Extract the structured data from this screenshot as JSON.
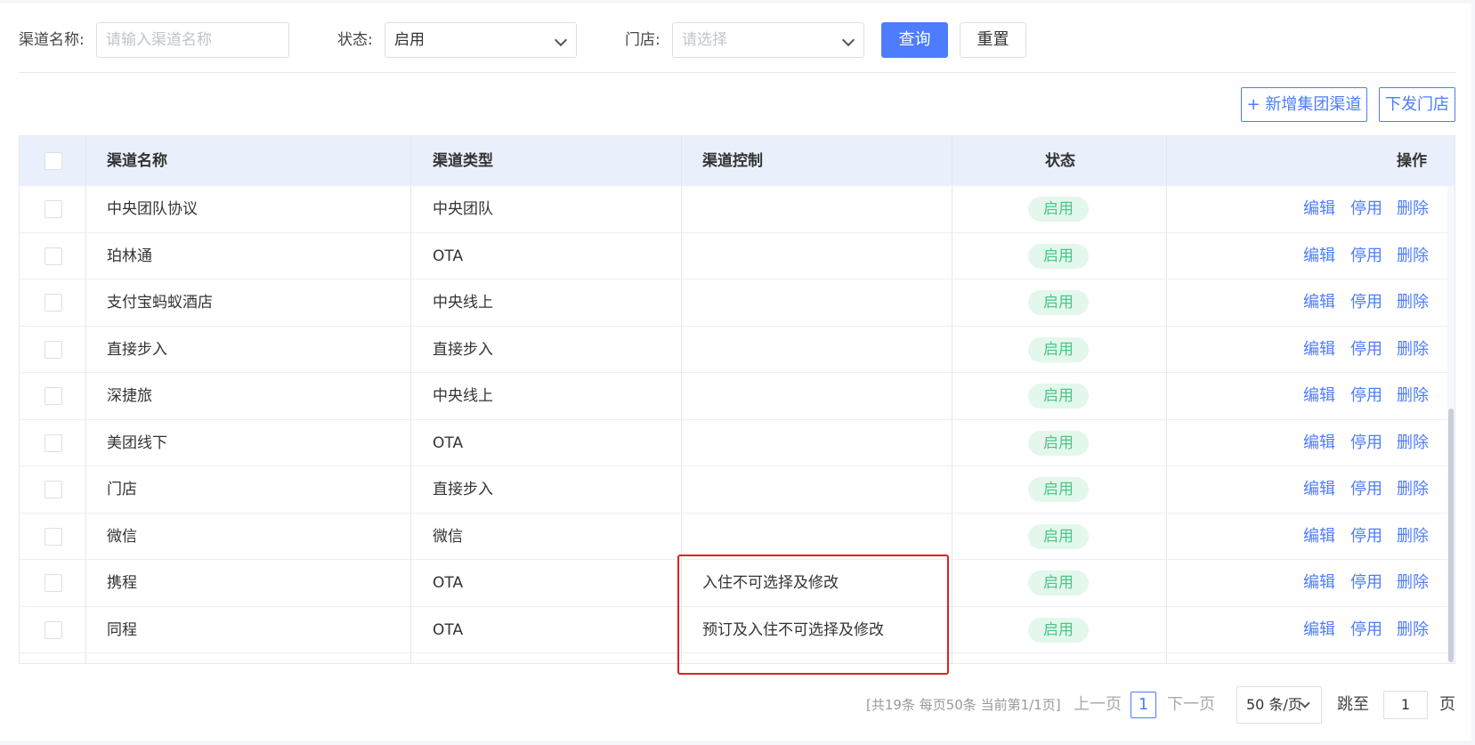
{
  "filters": {
    "channel_name_label": "渠道名称:",
    "channel_name_placeholder": "请输入渠道名称",
    "status_label": "状态:",
    "status_value": "启用",
    "store_label": "门店:",
    "store_placeholder": "请选择",
    "query_label": "查询",
    "reset_label": "重置"
  },
  "toolbar": {
    "add_group_channel_label": "+ 新增集团渠道",
    "dispatch_store_label": "下发门店"
  },
  "table": {
    "headers": {
      "name": "渠道名称",
      "type": "渠道类型",
      "control": "渠道控制",
      "status": "状态",
      "actions": "操作"
    },
    "action_labels": {
      "edit": "编辑",
      "disable": "停用",
      "delete": "删除"
    },
    "rows": [
      {
        "name": "中央团队协议",
        "type": "中央团队",
        "control": "",
        "status": "启用"
      },
      {
        "name": "珀林通",
        "type": "OTA",
        "control": "",
        "status": "启用"
      },
      {
        "name": "支付宝蚂蚁酒店",
        "type": "中央线上",
        "control": "",
        "status": "启用"
      },
      {
        "name": "直接步入",
        "type": "直接步入",
        "control": "",
        "status": "启用"
      },
      {
        "name": "深捷旅",
        "type": "中央线上",
        "control": "",
        "status": "启用"
      },
      {
        "name": "美团线下",
        "type": "OTA",
        "control": "",
        "status": "启用"
      },
      {
        "name": "门店",
        "type": "直接步入",
        "control": "",
        "status": "启用"
      },
      {
        "name": "微信",
        "type": "微信",
        "control": "",
        "status": "启用"
      },
      {
        "name": "携程",
        "type": "OTA",
        "control": "入住不可选择及修改",
        "status": "启用"
      },
      {
        "name": "同程",
        "type": "OTA",
        "control": "预订及入住不可选择及修改",
        "status": "启用"
      }
    ]
  },
  "pagination": {
    "info": "[共19条 每页50条 当前第1/1页]",
    "prev_label": "上一页",
    "current_page": "1",
    "next_label": "下一页",
    "page_size_label": "50 条/页",
    "jump_label": "跳至",
    "jump_value": "1",
    "page_suffix": "页"
  },
  "colors": {
    "primary": "#4d7cfe",
    "status_green": "#4cc58a",
    "status_bg": "#e3f7ec",
    "header_bg": "#eaf0fb",
    "highlight_red": "#e02020"
  }
}
